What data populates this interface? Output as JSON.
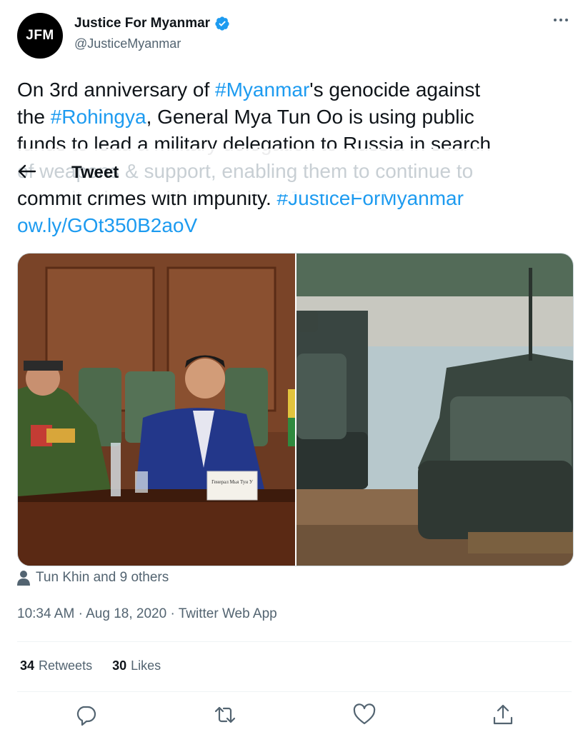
{
  "author": {
    "avatar_text": "JFM",
    "display_name": "Justice For Myanmar",
    "handle": "@JusticeMyanmar"
  },
  "tweet": {
    "line1_pre": "On 3rd anniversary of ",
    "hashtag1": "#Myanmar",
    "line1_post": "'s genocide against",
    "line2_pre": "the ",
    "hashtag2": "#Rohingya",
    "line2_post": ", General Mya Tun Oo is using public",
    "line3": "funds to lead a military delegation to Russia in search",
    "line5_pre": "commit crimes with impunity. ",
    "hashtag3": "#JusticeForMyanmar",
    "link": "ow.ly/GOt350B2aoV"
  },
  "overlay": {
    "ghost_text": "of weapons & support, enabling them to continue to",
    "title": "Tweet"
  },
  "media": {
    "left_placard": "Генерал Мья Тун У"
  },
  "tagged": "Tun Khin and 9 others",
  "meta": {
    "time": "10:34 AM",
    "date": "Aug 18, 2020",
    "source": "Twitter Web App",
    "separator": "·"
  },
  "stats": {
    "retweets_count": "34",
    "retweets_label": "Retweets",
    "likes_count": "30",
    "likes_label": "Likes"
  },
  "colors": {
    "link": "#1d9bf0",
    "text": "#0f1419",
    "secondary": "#536471"
  }
}
